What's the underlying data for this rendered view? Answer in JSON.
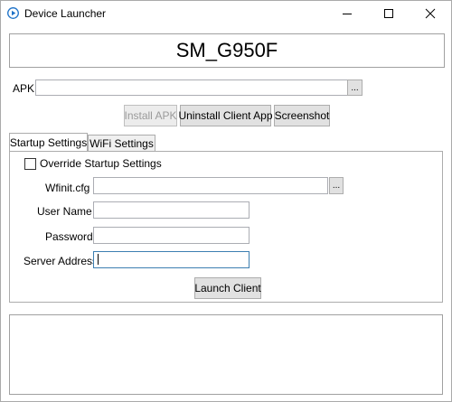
{
  "window": {
    "title": "Device Launcher",
    "icons": {
      "app": "play-circle-icon",
      "minimize": "minimize-icon",
      "maximize": "maximize-icon",
      "close": "close-icon"
    },
    "accent": "#1e72c8"
  },
  "device": {
    "name": "SM_G950F"
  },
  "apk": {
    "label": "APK",
    "value": "",
    "browse_label": "..."
  },
  "actions": {
    "install_label": "Install APK",
    "uninstall_label": "Uninstall Client App",
    "screenshot_label": "Screenshot"
  },
  "tabs": [
    {
      "label": "Startup Settings",
      "active": true
    },
    {
      "label": "WiFi Settings",
      "active": false
    }
  ],
  "startup": {
    "override_label": "Override Startup Settings",
    "override_checked": false,
    "wfinit_label": "Wfinit.cfg",
    "wfinit_value": "",
    "wfinit_browse_label": "...",
    "username_label": "User Name",
    "username_value": "",
    "password_label": "Password",
    "password_value": "",
    "server_label": "Server Address",
    "server_value": "",
    "launch_label": "Launch Client"
  },
  "log": {
    "text": ""
  }
}
